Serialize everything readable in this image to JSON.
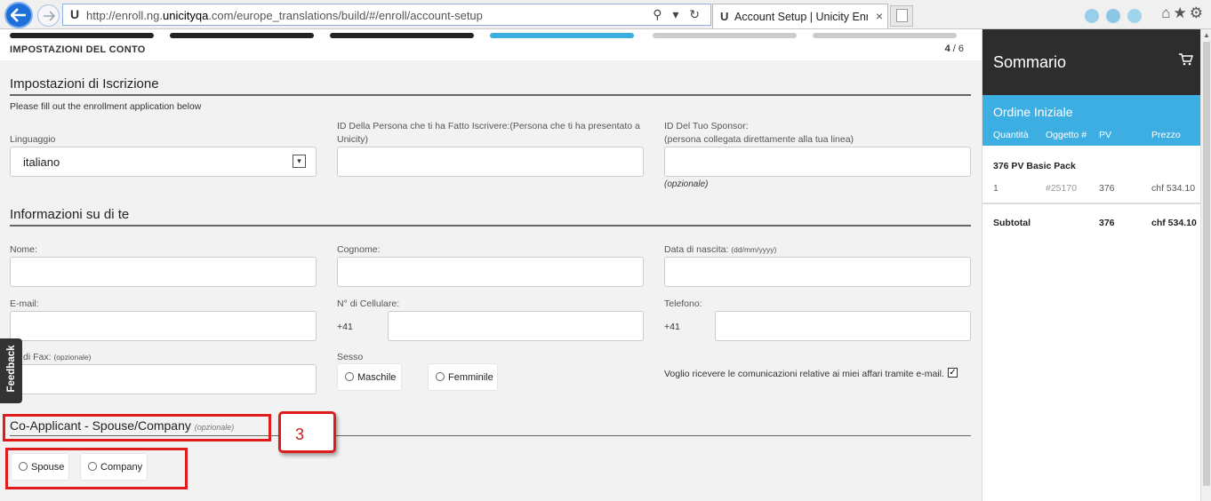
{
  "browser": {
    "url_prefix": "http://enroll.ng.",
    "url_domain": "unicityqa",
    "url_suffix": ".com/europe_translations/build/#/enroll/account-setup",
    "tab_title": "Account Setup | Unicity Enr...",
    "tab_close": "×",
    "site_icon": "U",
    "address_tools": "⚲ ▾ ↻",
    "right_icons": "⌂★⚙",
    "blur_colors": [
      "#3daee2",
      "#2a9de0",
      "#4db8ea"
    ]
  },
  "progress": {
    "title": "IMPOSTAZIONI DEL CONTO",
    "current": "4",
    "total": "/ 6",
    "segment_colors": [
      "#222222",
      "#222222",
      "#222222",
      "#3daee2",
      "#cccccc",
      "#cccccc"
    ]
  },
  "enrollment": {
    "heading": "Impostazioni di Iscrizione",
    "intro": "Please fill out the enrollment application below",
    "language_label": "Linguaggio",
    "language_value": "italiano",
    "language_arrow": "▾",
    "enroller_label": "ID Della Persona che ti ha Fatto Iscrivere:(Persona che ti ha presentato a Unicity)",
    "sponsor_label": "ID Del Tuo Sponsor:",
    "sponsor_sublabel": "(persona collegata direttamente alla tua linea)",
    "sponsor_optional": "(opzionale)"
  },
  "about": {
    "heading": "Informazioni su di te",
    "first_name_label": "Nome:",
    "last_name_label": "Cognome:",
    "dob_label": "Data di nascita:",
    "dob_hint": "(dd/mm/yyyy)",
    "email_label": "E-mail:",
    "mobile_label": "N° di Cellulare:",
    "mobile_prefix": "+41",
    "phone_label": "Telefono:",
    "phone_prefix": "+41",
    "fax_label": "di Fax:",
    "fax_hint": "(opzionale)",
    "gender_label": "Sesso",
    "gender_male": "Maschile",
    "gender_female": "Femminile",
    "email_consent": "Voglio ricevere le comunicazioni relative ai miei affari tramite e-mail.",
    "email_consent_mark": "✓"
  },
  "co_applicant": {
    "heading": "Co-Applicant - Spouse/Company",
    "optional": "(opzionale)",
    "spouse": "Spouse",
    "company": "Company"
  },
  "annotation": {
    "number": "3",
    "color": "#e01b1b"
  },
  "feedback": {
    "label": "Feedback"
  },
  "sidebar": {
    "title": "Sommario",
    "section": "Ordine Iniziale",
    "col_qty": "Quantità",
    "col_item": "Oggetto #",
    "col_pv": "PV",
    "col_price": "Prezzo",
    "product_name": "376 PV Basic Pack",
    "qty": "1",
    "item_no": "#25170",
    "pv": "376",
    "price": "chf 534.10",
    "subtotal_label": "Subtotal",
    "subtotal_pv": "376",
    "subtotal_price": "chf 534.10",
    "header_color": "#2d2d2d",
    "accent_color": "#3daee2"
  }
}
